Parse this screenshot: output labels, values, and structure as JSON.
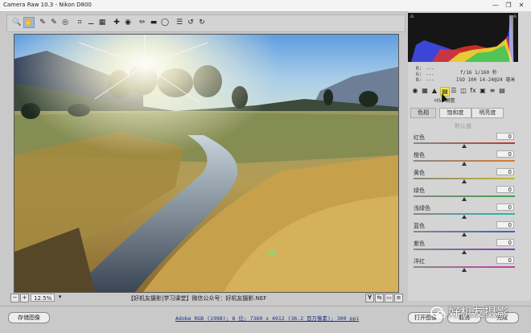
{
  "window": {
    "title": "Camera Raw 10.3  -  Nikon D800",
    "minimize": "—",
    "restore": "❐",
    "close": "✕"
  },
  "toolbar": {
    "tools": [
      "zoom-icon",
      "hand-icon",
      "eyedropper-icon",
      "color-sampler-icon",
      "target-adjust-icon",
      "crop-icon",
      "straighten-icon",
      "transform-icon",
      "spot-removal-icon",
      "red-eye-icon",
      "adjustment-brush-icon",
      "graduated-filter-icon",
      "radial-filter-icon",
      "preferences-icon",
      "rotate-ccw-icon",
      "rotate-cw-icon"
    ],
    "glyphs": [
      "🔍",
      "✋",
      "✎",
      "✎",
      "◎",
      "⌗",
      "⚊",
      "▦",
      "✚",
      "◉",
      "✏",
      "▬",
      "◯",
      "☰",
      "↺",
      "↻"
    ]
  },
  "camera_info": {
    "r": "R:",
    "g": "G:",
    "b": "B:",
    "r_val": "---",
    "g_val": "---",
    "b_val": "---",
    "aperture_shutter": "f/16  1/160 秒",
    "iso_lens": "ISO 100   14-24@24 毫米"
  },
  "panel": {
    "section_title": "HSL 调整",
    "tabs": [
      "basic-icon",
      "tone-curve-icon",
      "detail-icon",
      "hsl-icon",
      "split-toning-icon",
      "lens-icon",
      "effects-icon",
      "camera-calibration-icon",
      "presets-icon",
      "snapshots-icon"
    ],
    "tab_glyphs": [
      "◉",
      "▦",
      "▲",
      "▤",
      "☰",
      "◫",
      "fx",
      "▣",
      "≡",
      "▤"
    ],
    "subtabs": [
      "色相",
      "饱和度",
      "明亮度"
    ],
    "default_label": "默认值",
    "sliders": [
      {
        "label": "红色",
        "value": "0",
        "color": "#c0392b"
      },
      {
        "label": "橙色",
        "value": "0",
        "color": "#d97c2b"
      },
      {
        "label": "黄色",
        "value": "0",
        "color": "#c8b62c"
      },
      {
        "label": "绿色",
        "value": "0",
        "color": "#3fa14a"
      },
      {
        "label": "浅绿色",
        "value": "0",
        "color": "#2bb5b0"
      },
      {
        "label": "蓝色",
        "value": "0",
        "color": "#3d5fc4"
      },
      {
        "label": "紫色",
        "value": "0",
        "color": "#7a3fb5"
      },
      {
        "label": "洋红",
        "value": "0",
        "color": "#c43fa4"
      }
    ]
  },
  "status": {
    "zoom": "12.5%",
    "filename": "【好机友摄影|学习课堂】微信公众号：好机友摄影.NEF"
  },
  "bottom": {
    "save_label": "存储图像",
    "workflow_info": "Adobe RGB (1998); 8 位; 7360 x 4912 (36.2 百万像素); 300 ppi",
    "open_label": "打开图像",
    "cancel_label": "取消",
    "done_label": "完成"
  },
  "watermark": {
    "text": "好机友摄影"
  },
  "colors": {
    "accent_tab": "#f0e64a",
    "link": "#1c2f8a"
  }
}
